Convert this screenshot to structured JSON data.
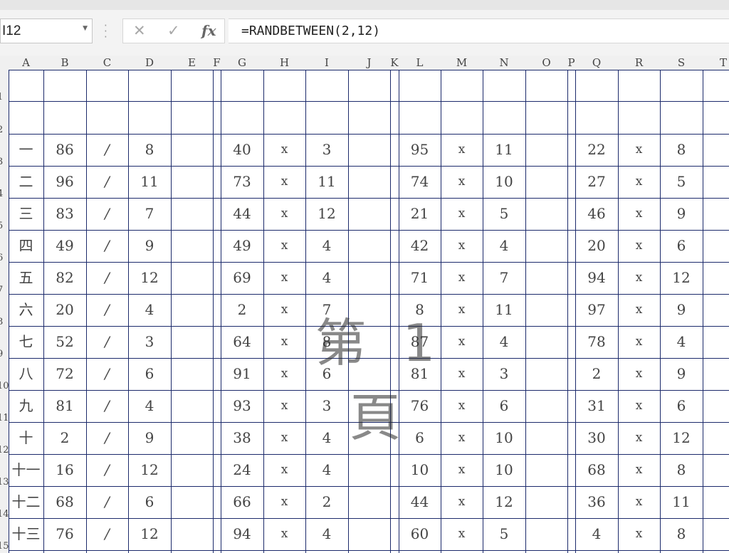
{
  "name_box": {
    "value": "I12",
    "dropdown_icon": "chevron-down-icon"
  },
  "formula_bar": {
    "separator_icon": "vertical-dots-icon",
    "cancel_icon": "close-icon",
    "confirm_icon": "check-icon",
    "function_label": "fx",
    "formula": "=RANDBETWEEN(2,12)"
  },
  "columns": [
    "A",
    "B",
    "C",
    "D",
    "E",
    "F",
    "G",
    "H",
    "I",
    "J",
    "K",
    "L",
    "M",
    "N",
    "O",
    "P",
    "Q",
    "R",
    "S",
    "T"
  ],
  "row_numbers": [
    "1",
    "2",
    "3",
    "4",
    "5",
    "6",
    "7",
    "8",
    "9",
    "10",
    "11",
    "12",
    "13",
    "14",
    "15"
  ],
  "watermark": "第 1 頁",
  "rows": [
    [
      "一",
      "86",
      "/",
      "8",
      "40",
      "x",
      "3",
      "95",
      "x",
      "11",
      "22",
      "x",
      "8"
    ],
    [
      "二",
      "96",
      "/",
      "11",
      "73",
      "x",
      "11",
      "74",
      "x",
      "10",
      "27",
      "x",
      "5"
    ],
    [
      "三",
      "83",
      "/",
      "7",
      "44",
      "x",
      "12",
      "21",
      "x",
      "5",
      "46",
      "x",
      "9"
    ],
    [
      "四",
      "49",
      "/",
      "9",
      "49",
      "x",
      "4",
      "42",
      "x",
      "4",
      "20",
      "x",
      "6"
    ],
    [
      "五",
      "82",
      "/",
      "12",
      "69",
      "x",
      "4",
      "71",
      "x",
      "7",
      "94",
      "x",
      "12"
    ],
    [
      "六",
      "20",
      "/",
      "4",
      "2",
      "x",
      "7",
      "8",
      "x",
      "11",
      "97",
      "x",
      "9"
    ],
    [
      "七",
      "52",
      "/",
      "3",
      "64",
      "x",
      "8",
      "87",
      "x",
      "4",
      "78",
      "x",
      "4"
    ],
    [
      "八",
      "72",
      "/",
      "6",
      "91",
      "x",
      "6",
      "81",
      "x",
      "3",
      "2",
      "x",
      "9"
    ],
    [
      "九",
      "81",
      "/",
      "4",
      "93",
      "x",
      "3",
      "76",
      "x",
      "6",
      "31",
      "x",
      "6"
    ],
    [
      "十",
      "2",
      "/",
      "9",
      "38",
      "x",
      "4",
      "6",
      "x",
      "10",
      "30",
      "x",
      "12"
    ],
    [
      "十一",
      "16",
      "/",
      "12",
      "24",
      "x",
      "4",
      "10",
      "x",
      "10",
      "68",
      "x",
      "8"
    ],
    [
      "十二",
      "68",
      "/",
      "6",
      "66",
      "x",
      "2",
      "44",
      "x",
      "12",
      "36",
      "x",
      "11"
    ],
    [
      "十三",
      "76",
      "/",
      "12",
      "94",
      "x",
      "4",
      "60",
      "x",
      "5",
      "4",
      "x",
      "8"
    ]
  ]
}
